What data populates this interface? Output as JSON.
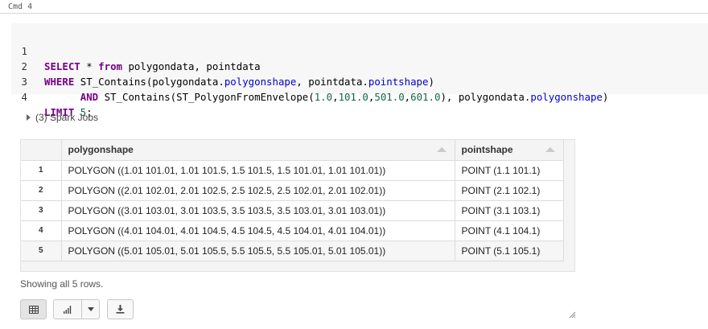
{
  "cell": {
    "label": "Cmd 4"
  },
  "code": {
    "lines": [
      {
        "num": "1",
        "tokens": [
          {
            "t": "SELECT",
            "c": "kw"
          },
          {
            "t": " * "
          },
          {
            "t": "from",
            "c": "kw"
          },
          {
            "t": " polygondata, pointdata"
          }
        ]
      },
      {
        "num": "2",
        "tokens": [
          {
            "t": "WHERE",
            "c": "kw"
          },
          {
            "t": " ST_Contains(polygondata."
          },
          {
            "t": "polygonshape",
            "c": "prop"
          },
          {
            "t": ", pointdata."
          },
          {
            "t": "pointshape",
            "c": "prop"
          },
          {
            "t": ")"
          }
        ]
      },
      {
        "num": "3",
        "tokens": [
          {
            "t": "      "
          },
          {
            "t": "AND",
            "c": "kw"
          },
          {
            "t": " ST_Contains(ST_PolygonFromEnvelope("
          },
          {
            "t": "1.0",
            "c": "num"
          },
          {
            "t": ","
          },
          {
            "t": "101.0",
            "c": "num"
          },
          {
            "t": ","
          },
          {
            "t": "501.0",
            "c": "num"
          },
          {
            "t": ","
          },
          {
            "t": "601.0",
            "c": "num"
          },
          {
            "t": "), polygondata."
          },
          {
            "t": "polygonshape",
            "c": "prop"
          },
          {
            "t": ")"
          }
        ]
      },
      {
        "num": "4",
        "tokens": [
          {
            "t": "LIMIT",
            "c": "kw"
          },
          {
            "t": " "
          },
          {
            "t": "5",
            "c": "num"
          },
          {
            "t": ";"
          }
        ]
      }
    ]
  },
  "jobs": {
    "label": "(3) Spark Jobs"
  },
  "table": {
    "columns": [
      "polygonshape",
      "pointshape"
    ],
    "rows": [
      {
        "n": "1",
        "polygonshape": "POLYGON ((1.01 101.01, 1.01 101.5, 1.5 101.5, 1.5 101.01, 1.01 101.01))",
        "pointshape": "POINT (1.1 101.1)"
      },
      {
        "n": "2",
        "polygonshape": "POLYGON ((2.01 102.01, 2.01 102.5, 2.5 102.5, 2.5 102.01, 2.01 102.01))",
        "pointshape": "POINT (2.1 102.1)"
      },
      {
        "n": "3",
        "polygonshape": "POLYGON ((3.01 103.01, 3.01 103.5, 3.5 103.5, 3.5 103.01, 3.01 103.01))",
        "pointshape": "POINT (3.1 103.1)"
      },
      {
        "n": "4",
        "polygonshape": "POLYGON ((4.01 104.01, 4.01 104.5, 4.5 104.5, 4.5 104.01, 4.01 104.01))",
        "pointshape": "POINT (4.1 104.1)"
      },
      {
        "n": "5",
        "polygonshape": "POLYGON ((5.01 105.01, 5.01 105.5, 5.5 105.5, 5.5 105.01, 5.01 105.01))",
        "pointshape": "POINT (5.1 105.1)"
      }
    ]
  },
  "status": {
    "showing": "Showing all 5 rows."
  },
  "toolbar": {
    "buttons": [
      {
        "name": "table-view-button",
        "icon": "table-icon"
      },
      {
        "name": "chart-view-button",
        "icon": "bar-chart-icon"
      },
      {
        "name": "chart-options-dropdown",
        "icon": "caret-down-icon"
      },
      {
        "name": "download-button",
        "icon": "download-icon"
      }
    ]
  }
}
